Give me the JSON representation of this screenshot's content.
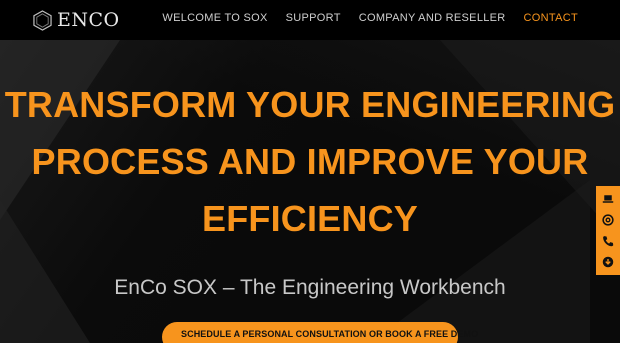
{
  "brand": {
    "logo_text": "ENCO"
  },
  "nav": {
    "items": [
      {
        "label": "WELCOME TO SOX"
      },
      {
        "label": "SUPPORT"
      },
      {
        "label": "COMPANY AND RESELLER"
      },
      {
        "label": "CONTACT"
      }
    ],
    "active_index": 3
  },
  "hero": {
    "title_lines": [
      "TRANSFORM YOUR ENGINEERING",
      "PROCESS AND IMPROVE YOUR",
      "EFFICIENCY"
    ],
    "subtitle": "EnCo SOX – The Engineering Workbench"
  },
  "cta": {
    "label": "SCHEDULE A PERSONAL CONSULTATION OR BOOK A FREE DEMO",
    "icon": "thumbs-up-icon"
  },
  "side_toolbar": {
    "icons": [
      "laptop-icon",
      "at-sign-icon",
      "phone-icon",
      "download-icon"
    ]
  },
  "colors": {
    "accent": "#f7941d",
    "header_bg": "#000000",
    "page_bg": "#0b0b0b"
  }
}
